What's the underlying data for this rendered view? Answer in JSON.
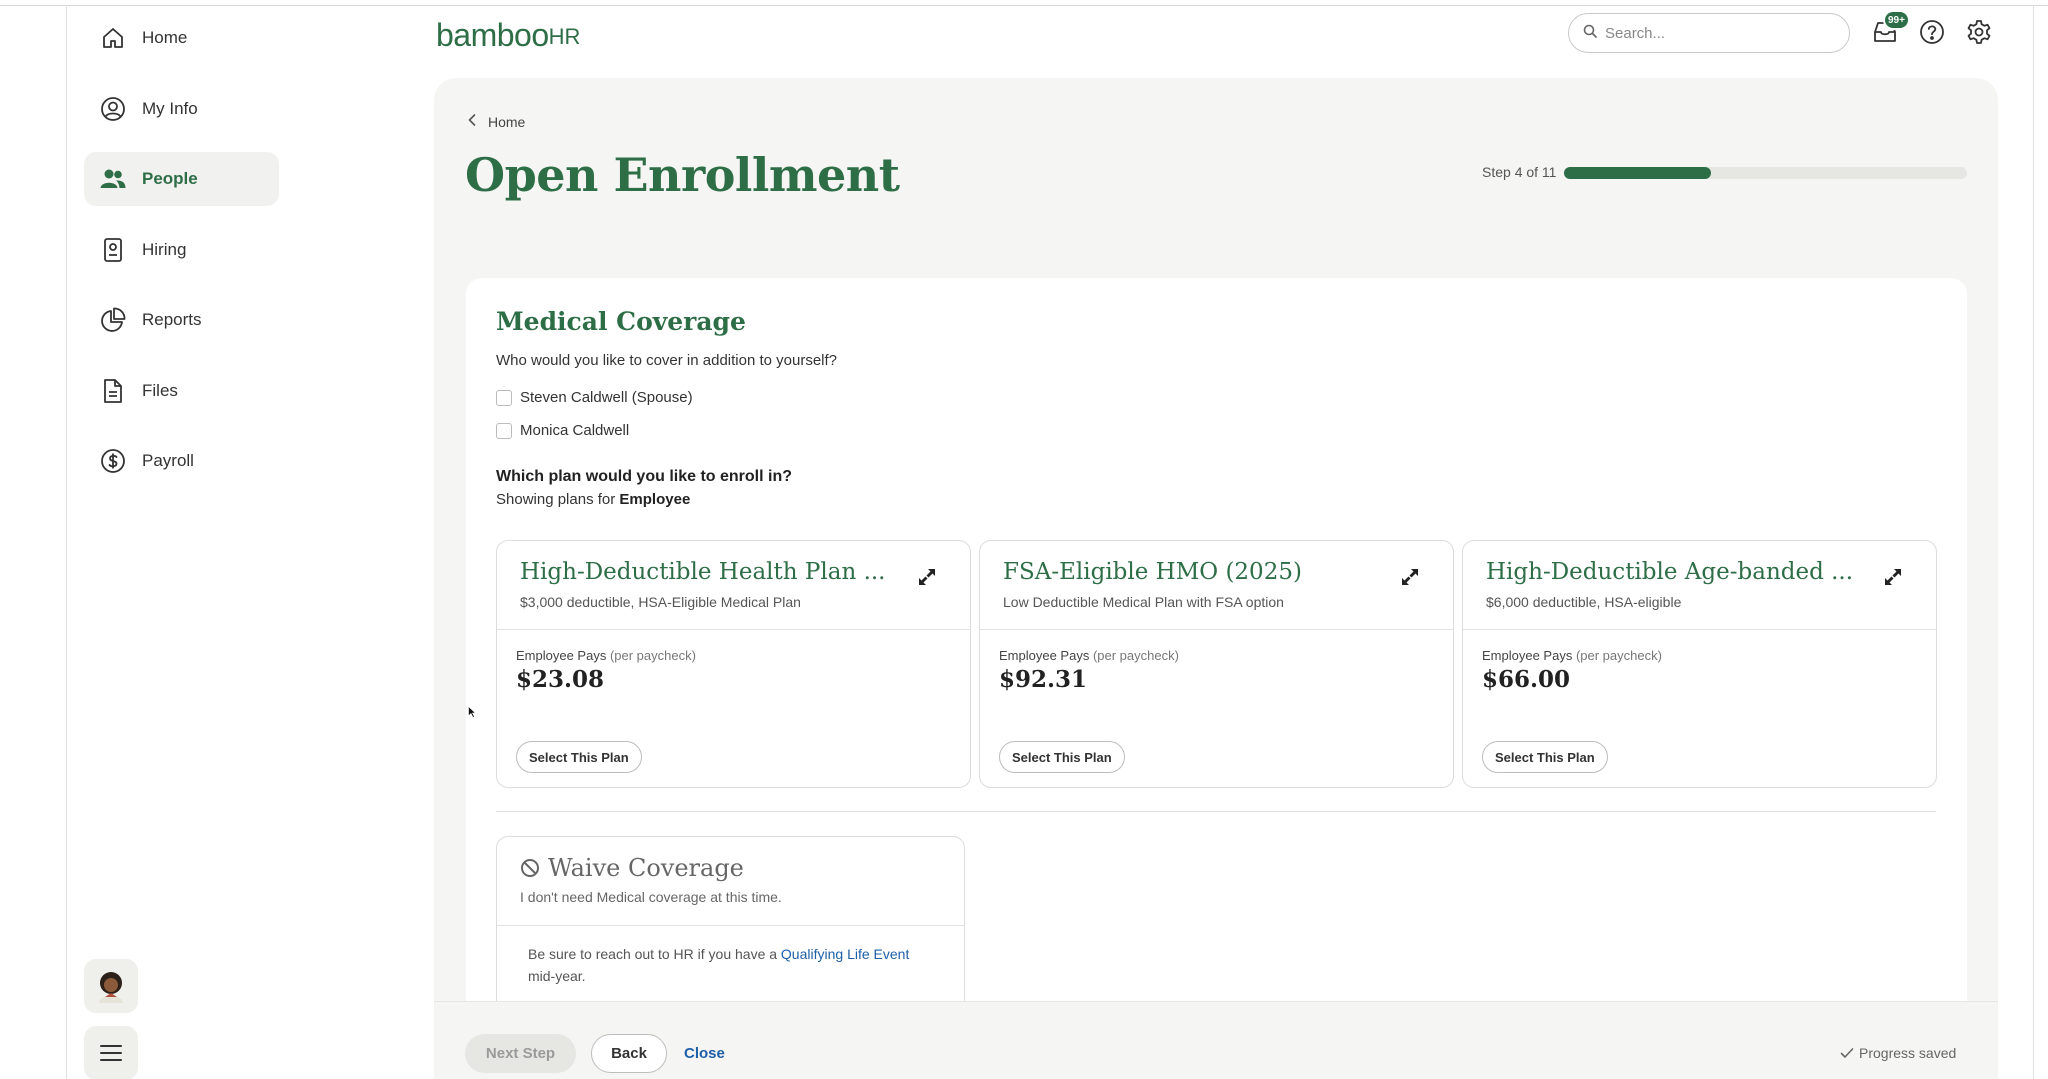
{
  "sidebar": {
    "items": [
      {
        "label": "Home",
        "icon": "home-icon"
      },
      {
        "label": "My Info",
        "icon": "user-circle-icon"
      },
      {
        "label": "People",
        "icon": "people-icon",
        "active": true
      },
      {
        "label": "Hiring",
        "icon": "id-badge-icon"
      },
      {
        "label": "Reports",
        "icon": "pie-chart-icon"
      },
      {
        "label": "Files",
        "icon": "file-icon"
      },
      {
        "label": "Payroll",
        "icon": "dollar-circle-icon"
      }
    ]
  },
  "header": {
    "logo_main": "bamboo",
    "logo_suffix": "HR",
    "search_placeholder": "Search...",
    "notification_badge": "99+"
  },
  "breadcrumb": {
    "label": "Home"
  },
  "page": {
    "title": "Open Enrollment",
    "step_label": "Step 4 of 11",
    "progress": 0.364
  },
  "medical": {
    "title": "Medical Coverage",
    "cover_question": "Who would you like to cover in addition to yourself?",
    "dependents": [
      "Steven Caldwell (Spouse)",
      "Monica Caldwell"
    ],
    "plan_question": "Which plan would you like to enroll in?",
    "showing_prefix": "Showing plans for",
    "showing_for": "Employee"
  },
  "plans": [
    {
      "title": "High-Deductible Health Plan ...",
      "subtitle": "$3,000 deductible, HSA-Eligible Medical Plan",
      "pays_label": "Employee Pays",
      "per": "(per paycheck)",
      "price": "$23.08",
      "button": "Select This Plan"
    },
    {
      "title": "FSA-Eligible HMO (2025)",
      "subtitle": "Low Deductible Medical Plan with FSA option",
      "pays_label": "Employee Pays",
      "per": "(per paycheck)",
      "price": "$92.31",
      "button": "Select This Plan"
    },
    {
      "title": "High-Deductible Age-banded ...",
      "subtitle": "$6,000 deductible, HSA-eligible",
      "pays_label": "Employee Pays",
      "per": "(per paycheck)",
      "price": "$66.00",
      "button": "Select This Plan"
    }
  ],
  "waive": {
    "title": "Waive Coverage",
    "subtitle": "I don't need Medical coverage at this time.",
    "note_prefix": "Be sure to reach out to HR if you have a",
    "note_link": "Qualifying Life Event",
    "note_suffix": "mid-year."
  },
  "footer": {
    "next": "Next Step",
    "back": "Back",
    "close": "Close",
    "saved": "Progress saved"
  },
  "colors": {
    "brand_green": "#2e6e47",
    "link_blue": "#1e5fa8",
    "panel_bg": "#f5f5f3"
  }
}
